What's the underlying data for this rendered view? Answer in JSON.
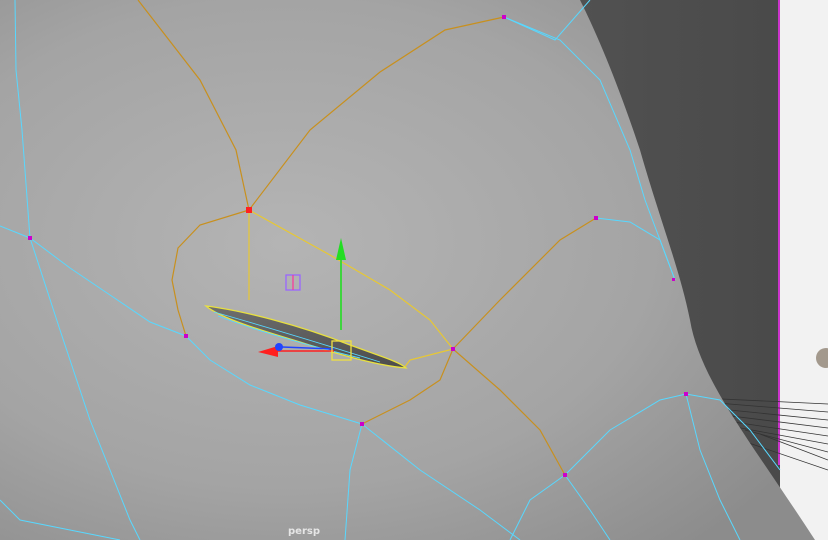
{
  "viewport": {
    "camera_label": "persp",
    "colors": {
      "background": "#5a5a5a",
      "background_right": "#4d4d4d",
      "mesh_face": "#a8a8a8",
      "wireframe": "#58d8ff",
      "selected_edge": "#e8c832",
      "selected_edge_dark": "#c8901e",
      "vertex": "#cc00cc",
      "selected_vertex": "#ff2020",
      "manip_x": "#ff2020",
      "manip_y": "#22dd22",
      "manip_z": "#2244ff",
      "manip_center": "#f0e040",
      "border_magenta": "#cc33cc"
    },
    "icons": [
      "move-tool-manipulator-icon",
      "pivot-icon"
    ]
  }
}
